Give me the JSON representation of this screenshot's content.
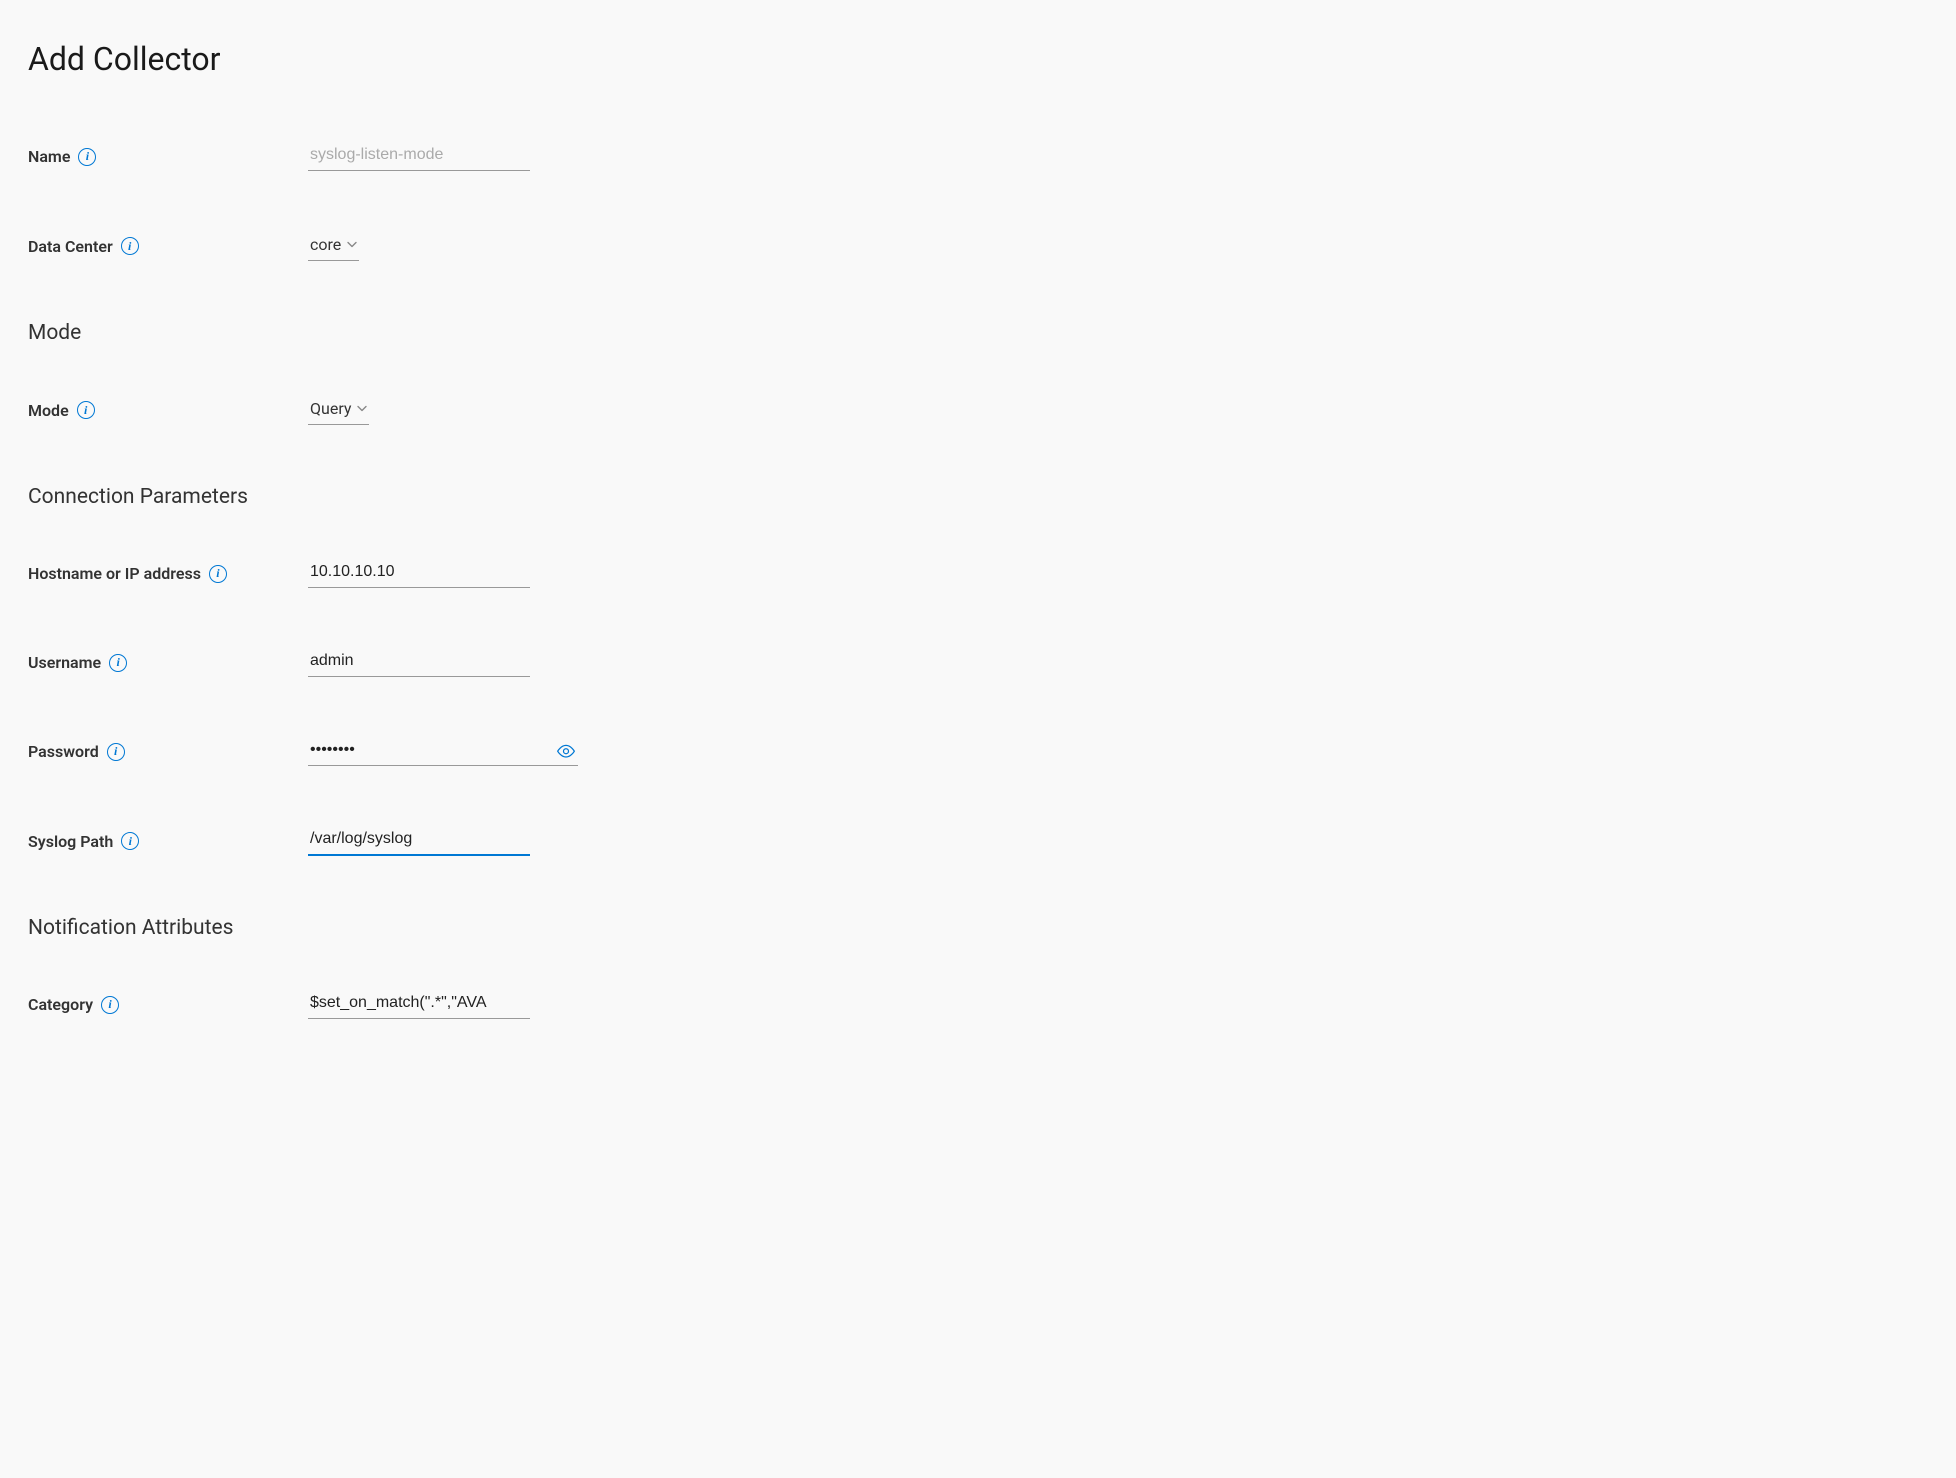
{
  "page": {
    "title": "Add Collector"
  },
  "form": {
    "name": {
      "label": "Name",
      "placeholder": "syslog-listen-mode",
      "value": ""
    },
    "data_center": {
      "label": "Data Center",
      "value": "core"
    },
    "mode_section": {
      "heading": "Mode",
      "mode": {
        "label": "Mode",
        "value": "Query"
      }
    },
    "connection_section": {
      "heading": "Connection Parameters",
      "hostname": {
        "label": "Hostname or IP address",
        "value": "10.10.10.10"
      },
      "username": {
        "label": "Username",
        "value": "admin"
      },
      "password": {
        "label": "Password",
        "value": "••••••••"
      },
      "syslog_path": {
        "label": "Syslog Path",
        "value": "/var/log/syslog"
      }
    },
    "notification_section": {
      "heading": "Notification Attributes",
      "category": {
        "label": "Category",
        "value": "$set_on_match(\".*\",\"AVA"
      }
    }
  }
}
